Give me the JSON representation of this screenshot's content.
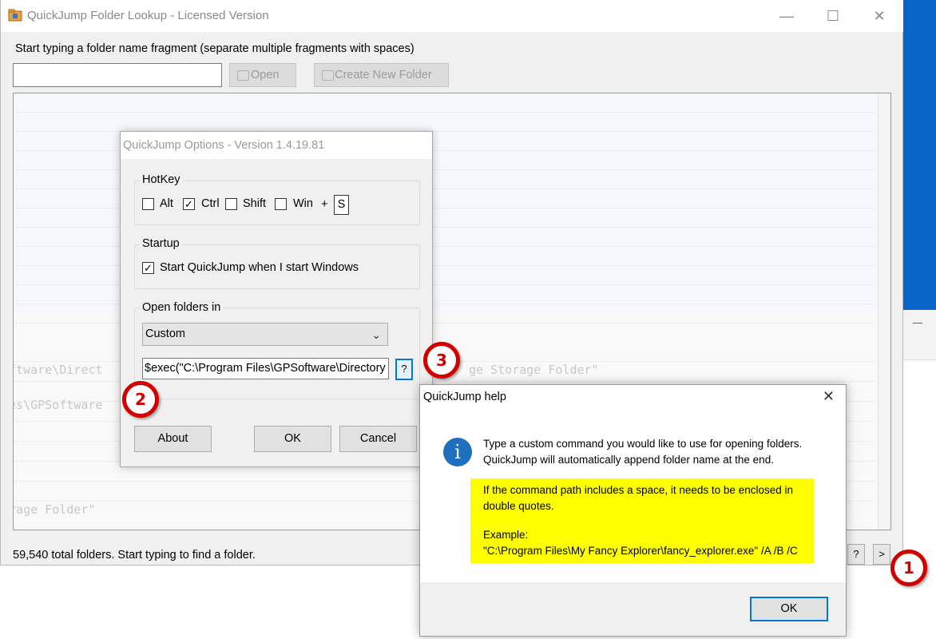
{
  "main_window": {
    "title": "QuickJump Folder Lookup - Licensed Version",
    "prompt": "Start typing a folder name fragment (separate multiple fragments with spaces)",
    "search_value": "",
    "open_label": "Open",
    "create_label": "Create New Folder",
    "status": "59,540 total folders.  Start typing to find a folder.",
    "help_btn": "?",
    "more_btn": ">",
    "minimize": "—",
    "maximize": "☐",
    "close": "✕"
  },
  "background_text": {
    "row1_left": "oftware\\Direct",
    "row1_right": "ge Storage Folder\"",
    "row2_left": "ies\\GPSoftware",
    "row3_left": "orage Folder\""
  },
  "options_dialog": {
    "title": "QuickJump Options - Version 1.4.19.81",
    "hotkey_group": "HotKey",
    "alt": "Alt",
    "ctrl": "Ctrl",
    "shift": "Shift",
    "win": "Win",
    "plus": "+",
    "key": "S",
    "alt_checked": false,
    "ctrl_checked": true,
    "shift_checked": false,
    "win_checked": false,
    "startup_group": "Startup",
    "startup_label": "Start QuickJump when I start Windows",
    "startup_checked": true,
    "open_group": "Open folders in",
    "open_selected": "Custom",
    "command_value": "$exec(\"C:\\Program Files\\GPSoftware\\Directory",
    "help_button": "?",
    "about": "About",
    "ok": "OK",
    "cancel": "Cancel"
  },
  "help_dialog": {
    "title": "QuickJump help",
    "close": "✕",
    "line1": "Type a custom command you would like to use for opening folders.",
    "line2": "QuickJump will automatically append folder name at the end.",
    "yellow_line1": "If the command path includes a space, it needs to be enclosed in",
    "yellow_line2": "double quotes.",
    "yellow_line3": "Example:",
    "yellow_line4": "\"C:\\Program Files\\My Fancy Explorer\\fancy_explorer.exe\" /A /B /C",
    "ok": "OK"
  },
  "callouts": {
    "one": "1",
    "two": "2",
    "three": "3",
    "color": "#d10000"
  }
}
